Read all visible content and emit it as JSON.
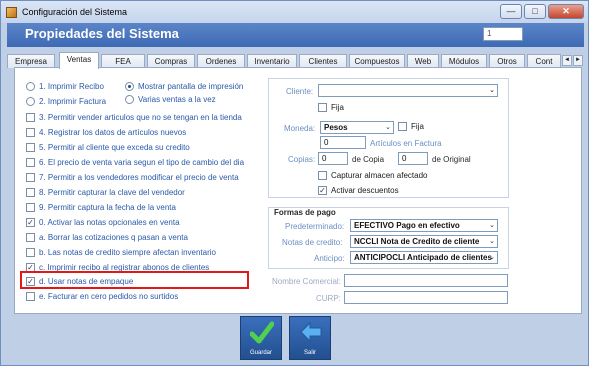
{
  "window": {
    "title": "Configuración del Sistema",
    "minimize": "—",
    "maximize": "□",
    "close": "✕"
  },
  "banner": {
    "title": "Propiedades del Sistema",
    "field_value": "1"
  },
  "tabs": [
    "Empresa",
    "Ventas",
    "FEA",
    "Compras",
    "Ordenes",
    "Inventario",
    "Clientes",
    "Compuestos",
    "Web",
    "Módulos",
    "Otros",
    "Cont"
  ],
  "tab_scroll": {
    "left": "◄",
    "right": "►"
  },
  "left_options": {
    "r1": "1. Imprimir Recibo",
    "r2": "2. Imprimir Factura",
    "r3": "Mostrar pantalla de impresión",
    "r4": "Varias ventas a la vez",
    "c3": "3. Permitir vender articulos que no se tengan en la tienda",
    "c4": "4. Registrar los datos de artículos nuevos",
    "c5": "5. Permitir al cliente que exceda su credito",
    "c6": "6. El precio de venta varia segun el tipo de cambio del dia",
    "c7": "7. Permitir a los vendedores modificar el precio de venta",
    "c8": "8. Permitir capturar la clave del vendedor",
    "c9": "9. Permitir captura la fecha de la venta",
    "c0": "0. Activar las notas opcionales en venta",
    "ca": "a. Borrar las cotizaciones q pasan a venta",
    "cb": "b. Las notas de credito siempre afectan inventario",
    "cc": "c. Imprimir recibo al registrar abonos de clientes",
    "cd": "d. Usar notas de empaque",
    "ce": "e. Facturar en cero pedidos no surtidos"
  },
  "right": {
    "cliente_label": "Cliente:",
    "fija1": "Fija",
    "moneda_label": "Moneda:",
    "moneda_value": "Pesos",
    "fija2": "Fija",
    "articulos_value": "0",
    "articulos_label": "Artículos en Factura",
    "copias_label": "Copias:",
    "copias_value": "0",
    "de_copia": "de Copia",
    "original_value": "0",
    "de_original": "de Original",
    "capturar": "Capturar almacen afectado",
    "activar": "Activar descuentos"
  },
  "payment": {
    "title": "Formas de pago",
    "predeterminado_label": "Predeterminado:",
    "predeterminado_value": "EFECTIVO Pago en efectivo",
    "notas_label": "Notas de credito:",
    "notas_value": "NCCLI Nota de Credito de cliente",
    "anticipo_label": "Anticipo:",
    "anticipo_value": "ANTICIPOCLI Anticipado de clientes"
  },
  "extra": {
    "nombre_label": "Nombre Comercial:",
    "curp_label": "CURP:"
  },
  "buttons": {
    "guardar": "Guardar",
    "salir": "Salir"
  },
  "colors": {
    "accent": "#3e69b4",
    "highlight": "#e01818"
  }
}
